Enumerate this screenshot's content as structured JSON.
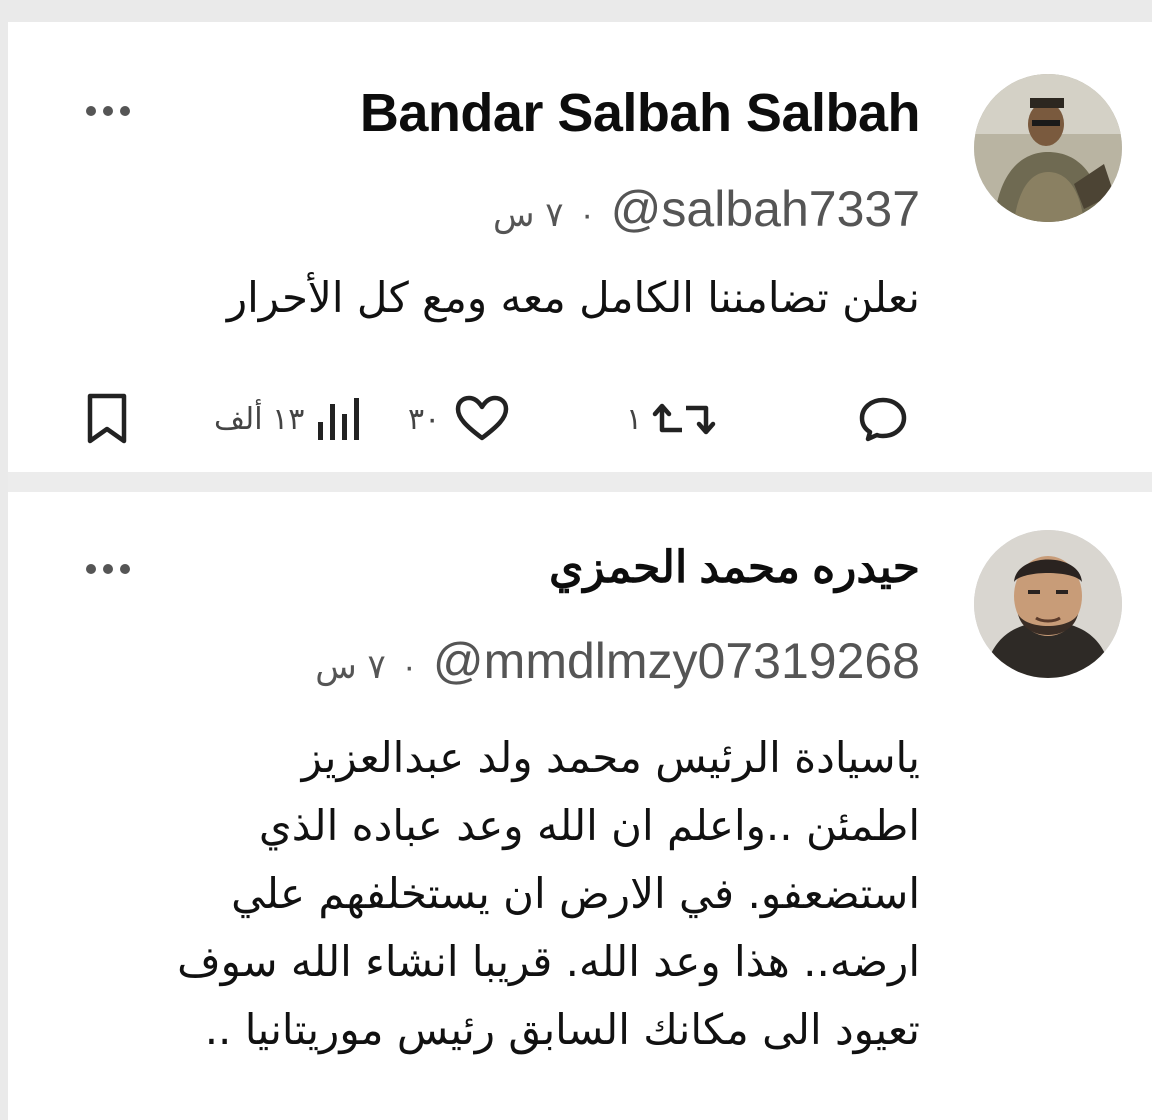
{
  "posts": [
    {
      "name": "Bandar Salbah Salbah",
      "handle": "@salbah7337",
      "separator": "·",
      "time": "٧ س",
      "text_lines": [
        "نعلن تضامننا الكامل معه ومع كل الأحرار"
      ],
      "actions": {
        "reply_icon": "reply-icon",
        "repost_icon": "repost-icon",
        "repost_count": "١",
        "like_icon": "heart-icon",
        "like_count": "٣٠",
        "views_icon": "views-chart-icon",
        "views_count": "١٣ ألف",
        "bookmark_icon": "bookmark-icon"
      }
    },
    {
      "name": "حيدره محمد الحمزي",
      "handle": "@mmdlmzy07319268",
      "separator": "·",
      "time": "٧ س",
      "text_lines": [
        "ياسيادة الرئيس محمد ولد عبدالعزيز",
        "اطمئن  ..واعلم ان الله وعد عباده الذي",
        "استضعفو. في الارض ان يستخلفهم علي",
        "ارضه.. هذا وعد الله. قريبا انشاء الله سوف",
        "تعيود الى مكانك السابق رئيس موريتانيا .."
      ]
    }
  ],
  "colors": {
    "text": "#111111",
    "muted": "#555555",
    "separator": "#ececec",
    "background": "#ffffff"
  }
}
